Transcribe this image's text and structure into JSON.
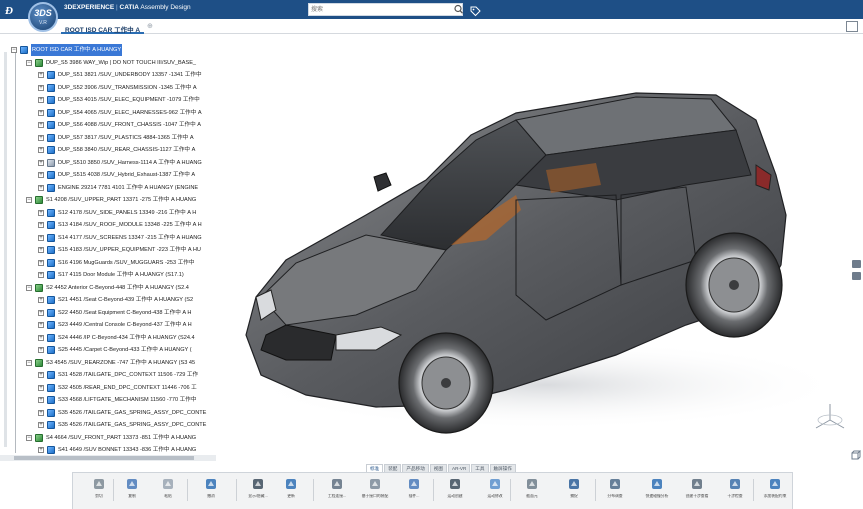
{
  "app": {
    "brand": "3DEXPERIENCE",
    "separator": " | ",
    "product": "CATIA",
    "module": " Assembly Design",
    "compass_label": "3DS",
    "compass_version": "V.R"
  },
  "search": {
    "placeholder": "搜索"
  },
  "tab": {
    "label": "ROOT ISD CAR 工作中 A"
  },
  "tree": {
    "rows": [
      {
        "label": "ROOT ISD CAR 工作中 A HUANGY",
        "icon": "assy",
        "selected": true
      },
      {
        "label": "DUP_S5 3986 WAY_Wip | DO NOT TOUCH III/SUV_BASE_",
        "icon": "prod"
      },
      {
        "label": "DUP_S51 3821 /SUV_UNDERBODY 13357 -1341 工作中",
        "icon": "assy"
      },
      {
        "label": "DUP_S52 3906 /SUV_TRANSMISSION -1345 工作中 A",
        "icon": "assy"
      },
      {
        "label": "DUP_S53 4015 /SUV_ELEC_EQUIPMENT -1079 工作中",
        "icon": "assy"
      },
      {
        "label": "DUP_S54 4065 /SUV_ELEC_HARNESSES-962 工作中 A",
        "icon": "assy"
      },
      {
        "label": "DUP_S56 4088 /SUV_FRONT_CHASSIS -1047 工作中 A",
        "icon": "assy"
      },
      {
        "label": "DUP_S57 3817 /SUV_PLASTICS 4884-1365 工作中 A",
        "icon": "assy"
      },
      {
        "label": "DUP_S58 3840 /SUV_REAR_CHASSIS-1127 工作中 A",
        "icon": "assy"
      },
      {
        "label": "DUP_S510 3850 /SUV_Harness-1114 A 工作中 A HUANG",
        "icon": "eng"
      },
      {
        "label": "DUP_S515 4038 /SUV_Hybrid_Exhaust-1387 工作中 A",
        "icon": "assy"
      },
      {
        "label": "ENGINE 29214 7781 4101 工作中 A HUANGY (ENGINE",
        "icon": "assy"
      },
      {
        "label": "S1 4208 /SUV_UPPER_PART 13371 -275 工作中 A HUANG",
        "icon": "prod"
      },
      {
        "label": "S12 4178 /SUV_SIDE_PANELS 13349 -216 工作中 A H",
        "icon": "assy"
      },
      {
        "label": "S13 4184 /SUV_ROOF_MODULE 13348 -225 工作中 A H",
        "icon": "assy"
      },
      {
        "label": "S14 4177 /SUV_SCREENS 13347 -215 工作中 A HUANG",
        "icon": "assy"
      },
      {
        "label": "S15 4183 /SUV_UPPER_EQUIPMENT -223 工作中 A HU",
        "icon": "assy"
      },
      {
        "label": "S16 4196 MugGuards /SUV_MUGGUARS -253 工作中",
        "icon": "assy"
      },
      {
        "label": "S17 4115 Door Module 工作中 A HUANGY (S17.1)",
        "icon": "assy"
      },
      {
        "label": "S2 4452 Anterior C-Beyond-448 工作中 A HUANGY (S2.4",
        "icon": "prod"
      },
      {
        "label": "S21 4451 /Seat C-Beyond-439 工作中 A HUANGY (S2",
        "icon": "assy"
      },
      {
        "label": "S22 4450 /Seat Equipment C-Beyond-438 工作中 A H",
        "icon": "assy"
      },
      {
        "label": "S23 4449 /Central Console C-Beyond-437 工作中 A H",
        "icon": "assy"
      },
      {
        "label": "S24 4446 /IP C-Beyond-434 工作中 A HUANGY (S24.4",
        "icon": "assy"
      },
      {
        "label": "S25 4445 /Carpet C-Beyond-433 工作中 A HUANGY (",
        "icon": "assy"
      },
      {
        "label": "S3 4545 /SUV_REARZONE -747 工作中 A HUANGY (S3 45",
        "icon": "prod"
      },
      {
        "label": "S31 4528 /TAILGATE_DPC_CONTEXT 11506 -729 工作",
        "icon": "assy"
      },
      {
        "label": "S32 4505 /REAR_END_DPC_CONTEXT 11446 -706 工",
        "icon": "assy"
      },
      {
        "label": "S33 4568 /LIFTGATE_MECHANISM 11560 -770 工作中",
        "icon": "assy"
      },
      {
        "label": "S35 4526 /TAILGATE_GAS_SPRING_ASSY_DPC_CONTE",
        "icon": "assy"
      },
      {
        "label": "S35 4526 /TAILGATE_GAS_SPRING_ASSY_DPC_CONTE",
        "icon": "assy"
      },
      {
        "label": "S4 4664 /SUV_FRONT_PART 13373 -851 工作中 A HUANG",
        "icon": "prod"
      },
      {
        "label": "S41 4649 /SUV BONNET 13343 -836 工作中 A HUANG",
        "icon": "assy"
      }
    ]
  },
  "action_tabs": [
    "标准",
    "装配",
    "产品移动",
    "视图",
    "AR-VR",
    "工具",
    "触屏操作"
  ],
  "tools": [
    {
      "label": "剪切",
      "icon": "scissors-icon"
    },
    {
      "label": "复制",
      "icon": "copy-icon"
    },
    {
      "label": "粘贴",
      "icon": "paste-icon"
    },
    {
      "label": "撤消",
      "icon": "undo-icon"
    },
    {
      "label": "显示/隐藏...",
      "icon": "zoom-icon"
    },
    {
      "label": "更新",
      "icon": "update-icon"
    },
    {
      "label": "工程连接...",
      "icon": "engineering-connection-icon"
    },
    {
      "label": "基于接口的装配",
      "icon": "interface-assembly-icon"
    },
    {
      "label": "插件...",
      "icon": "plugin-icon"
    },
    {
      "label": "运动创建",
      "icon": "motion-icon"
    },
    {
      "label": "运动修改",
      "icon": "motion-edit-icon"
    },
    {
      "label": "截面元",
      "icon": "section-icon"
    },
    {
      "label": "捕捉",
      "icon": "snap-icon"
    },
    {
      "label": "分布调查",
      "icon": "distribution-icon"
    },
    {
      "label": "快速碰撞分析",
      "icon": "clash-icon"
    },
    {
      "label": "创建干涉查看",
      "icon": "interference-icon"
    },
    {
      "label": "干涉检查",
      "icon": "interference-check-icon"
    },
    {
      "label": "添加装配约束",
      "icon": "constraint-icon"
    }
  ]
}
